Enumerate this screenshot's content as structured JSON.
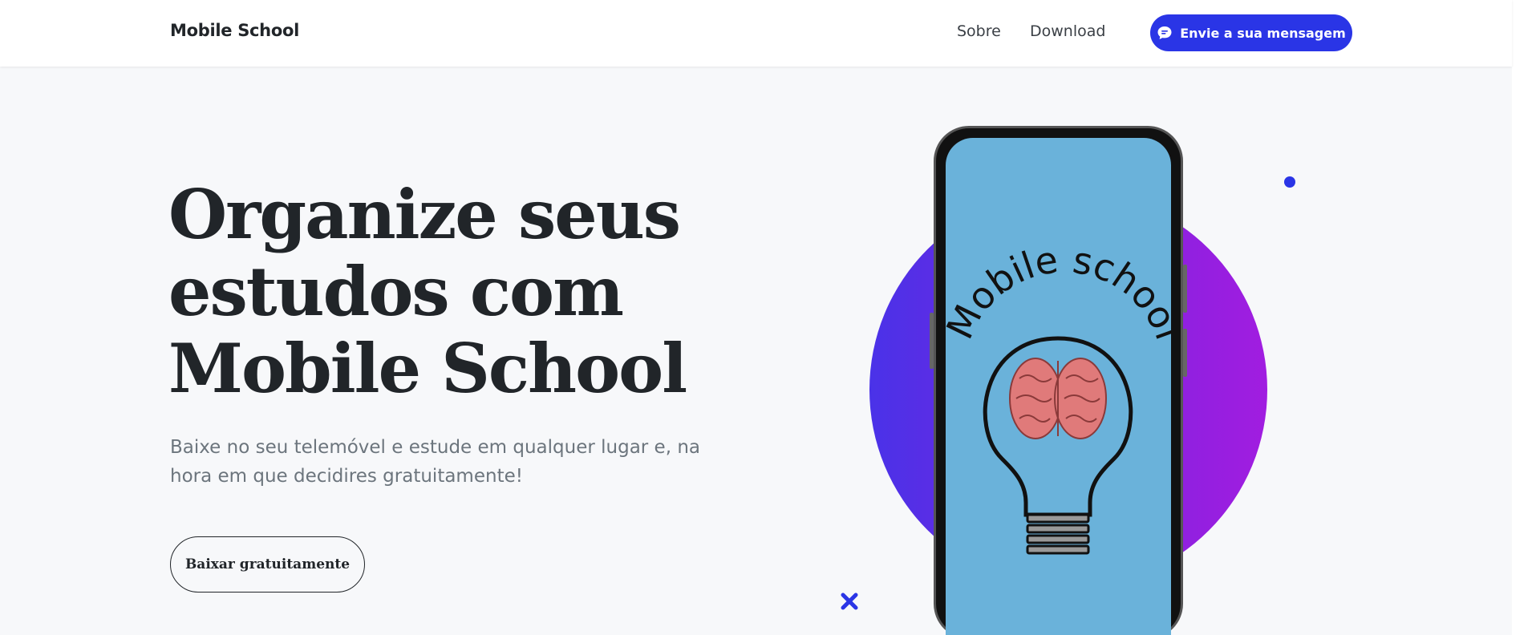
{
  "nav": {
    "brand": "Mobile School",
    "links": [
      "Sobre",
      "Download"
    ],
    "cta_label": "Envie a sua mensagem"
  },
  "hero": {
    "title_lines": [
      "Organize seus",
      "estudos com",
      "Mobile School"
    ],
    "subtitle": "Baixe no seu telemóvel e estude em qualquer lugar e, na hora em que decidires gratuitamente!",
    "button_label": "Baixar gratuitamente"
  },
  "illustration": {
    "logo_text": "Mobile school",
    "screen_color": "#6ab2da",
    "circle_gradient": [
      "#4a32e8",
      "#a11de0"
    ],
    "accent": "#2a35e6"
  },
  "icons": {
    "cta_icon": "chat-bubble-icon",
    "decor_dot": "dot-icon",
    "decor_cross": "cross-icon"
  }
}
